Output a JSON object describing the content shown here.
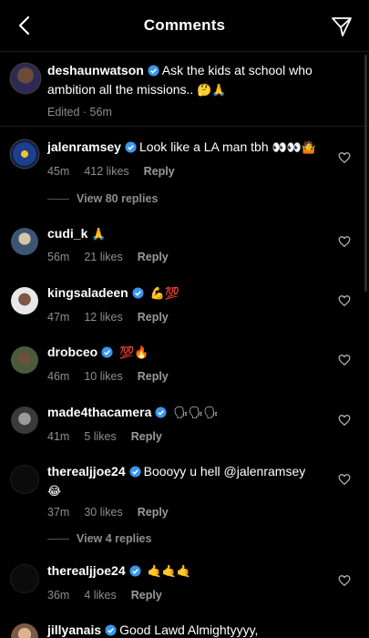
{
  "header": {
    "title": "Comments"
  },
  "caption": {
    "username": "deshaunwatson",
    "text": "Ask the kids at school who ambition all the missions..",
    "emoji": "🤔🙏",
    "edited": "Edited · 56m"
  },
  "comments": [
    {
      "username": "jalenramsey",
      "text": "Look like a LA man tbh",
      "emoji": "👀👀🤷",
      "time": "45m",
      "likes": "412 likes",
      "reply": "Reply",
      "view_replies": "View 80 replies"
    },
    {
      "username": "cudi_k",
      "text": "",
      "emoji": "🙏",
      "time": "56m",
      "likes": "21 likes",
      "reply": "Reply"
    },
    {
      "username": "kingsaladeen",
      "text": "",
      "emoji": "💪💯",
      "time": "47m",
      "likes": "12 likes",
      "reply": "Reply"
    },
    {
      "username": "drobceo",
      "text": "",
      "emoji": "💯🔥",
      "time": "46m",
      "likes": "10 likes",
      "reply": "Reply"
    },
    {
      "username": "made4thacamera",
      "text": "",
      "emoji": "🗣🗣🗣",
      "time": "41m",
      "likes": "5 likes",
      "reply": "Reply"
    },
    {
      "username": "therealjjoe24",
      "text": "Boooyy u hell @jalenramsey",
      "emoji": "😂",
      "time": "37m",
      "likes": "30 likes",
      "reply": "Reply",
      "view_replies": "View 4 replies"
    },
    {
      "username": "therealjjoe24",
      "text": "",
      "emoji": "🤙🤙🤙",
      "time": "36m",
      "likes": "4 likes",
      "reply": "Reply"
    },
    {
      "username": "jillyanais",
      "text": "Good Lawd Almightyyyy,",
      "emoji": ""
    }
  ],
  "colors": {
    "background": "#000000",
    "verified": "#3897f0",
    "muted": "#8e8e8e"
  }
}
